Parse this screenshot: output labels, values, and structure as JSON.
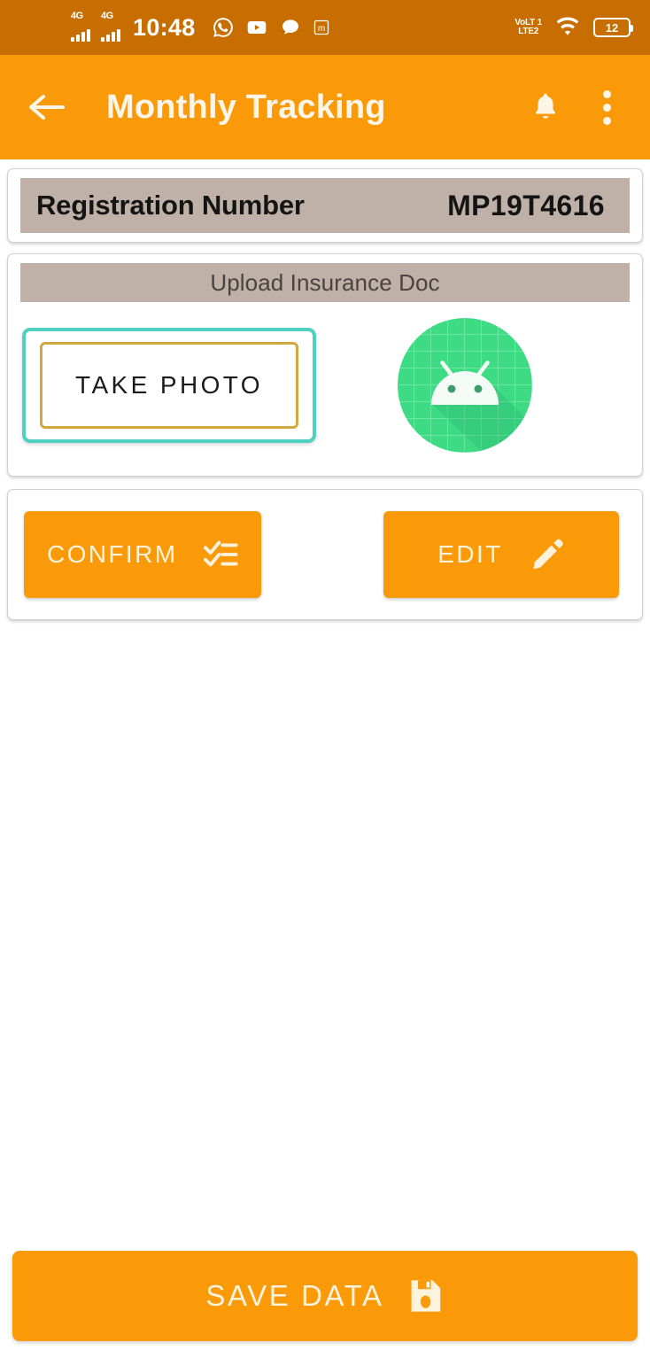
{
  "status_bar": {
    "network_label_1": "4G",
    "network_label_2": "4G",
    "time": "10:48",
    "app_icons": [
      "whatsapp-icon",
      "youtube-icon",
      "chat-bubble-icon",
      "m-badge-icon"
    ],
    "volte_line1": "VoLT 1",
    "volte_line2": "LTE2",
    "wifi": "wifi-icon",
    "battery_level": "12",
    "background_color": "#c86e00"
  },
  "app_bar": {
    "back_label": "back-arrow",
    "title": "Monthly Tracking",
    "notification_icon": "bell-icon",
    "overflow_icon": "more-vertical-icon",
    "background_color": "#fa9a08",
    "text_color": "#fdf6e8"
  },
  "registration": {
    "label": "Registration Number",
    "value": "MP19T4616",
    "bar_color": "#bfb0a8"
  },
  "upload_section": {
    "header": "Upload Insurance Doc",
    "take_photo_label": "TAKE PHOTO",
    "outer_border_color": "#4fd1c1",
    "inner_border_color": "#d2a73f",
    "thumbnail": "android-robot-placeholder",
    "thumbnail_color": "#3ddc84"
  },
  "actions": {
    "confirm_label": "CONFIRM",
    "confirm_icon": "checklist-icon",
    "edit_label": "EDIT",
    "edit_icon": "pencil-icon",
    "button_color": "#fa9a08"
  },
  "save": {
    "label": "SAVE DATA",
    "icon": "floppy-disk-icon",
    "button_color": "#fa9a08"
  }
}
